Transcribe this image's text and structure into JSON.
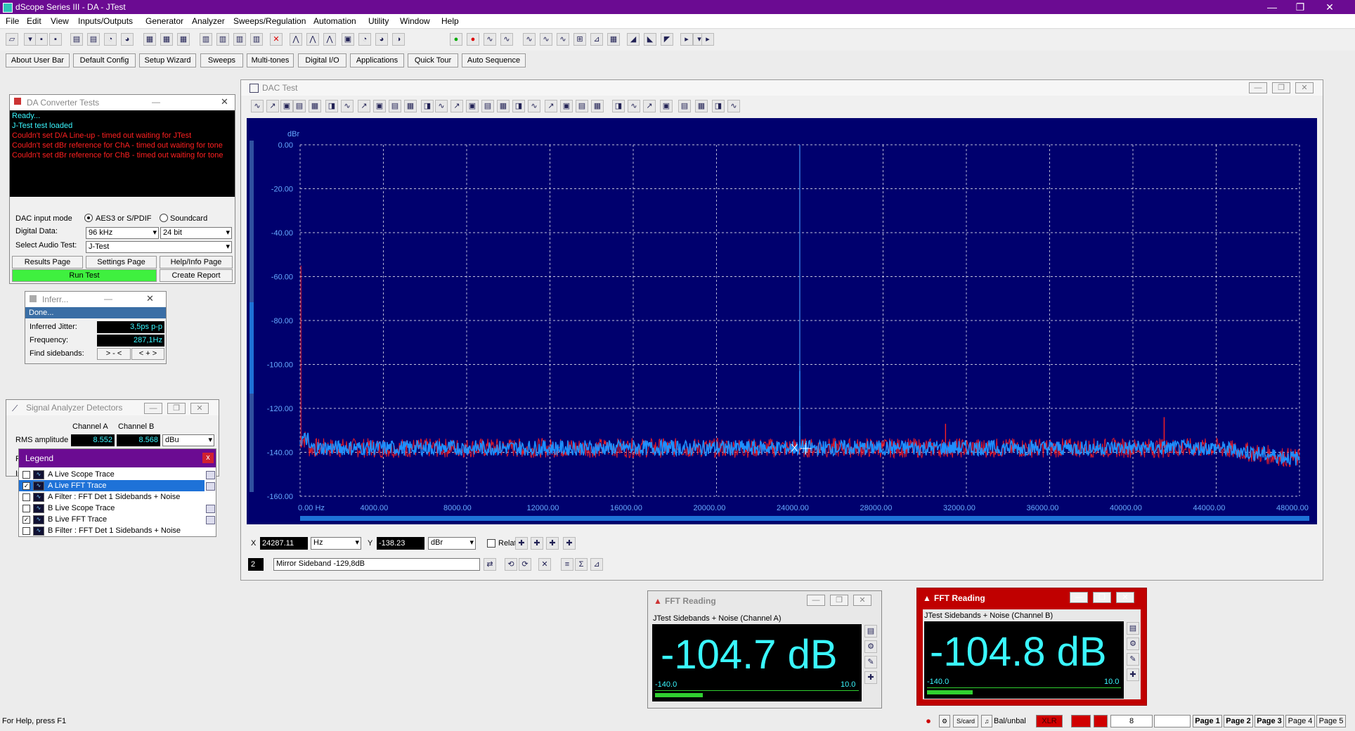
{
  "app": {
    "title": "dScope Series III - DA - JTest"
  },
  "window_controls": {
    "minimize": "—",
    "restore": "❐",
    "close": "✕"
  },
  "menus": [
    "File",
    "Edit",
    "View",
    "Inputs/Outputs",
    "Generator",
    "Analyzer",
    "Sweeps/Regulation",
    "Automation",
    "Utility",
    "Window",
    "Help"
  ],
  "user_bar": [
    "About User Bar",
    "Default Config",
    "Setup Wizard",
    "Sweeps",
    "Multi-tones",
    "Digital I/O",
    "Applications",
    "Quick Tour",
    "Auto Sequence"
  ],
  "dac_tests": {
    "title": "DA Converter Tests",
    "log": [
      {
        "text": "Ready...",
        "color": "#3af7ff"
      },
      {
        "text": "J-Test test loaded",
        "color": "#3af7ff"
      },
      {
        "text": "Couldn't set D/A Line-up - timed out waiting for JTest",
        "color": "#ff2020"
      },
      {
        "text": "Couldn't set dBr reference for ChA - timed out waiting for tone",
        "color": "#ff2020"
      },
      {
        "text": "Couldn't set dBr reference for ChB - timed out waiting for tone",
        "color": "#ff2020"
      }
    ],
    "input_mode_label": "DAC input mode",
    "radio_aes": "AES3 or S/PDIF",
    "radio_soundcard": "Soundcard",
    "digital_data_label": "Digital Data:",
    "sample_rate": "96 kHz",
    "bit_depth": "24 bit",
    "select_test_label": "Select Audio Test:",
    "selected_test": "J-Test",
    "results_page": "Results Page",
    "settings_page": "Settings Page",
    "help_page": "Help/Info Page",
    "run_test": "Run Test",
    "create_report": "Create Report"
  },
  "inferred": {
    "title": "Inferr...",
    "status": "Done...",
    "jitter_label": "Inferred Jitter:",
    "jitter_value": "3,5ps p-p",
    "freq_label": "Frequency:",
    "freq_value": "287,1Hz",
    "sidebands_label": "Find sidebands:",
    "btn_left": "> - <",
    "btn_right": "< + >"
  },
  "detectors": {
    "title": "Signal Analyzer Detectors",
    "col_a": "Channel A",
    "col_b": "Channel B",
    "row_label": "RMS amplitude",
    "val_a": "8.552",
    "val_b": "8.568",
    "unit": "dBu",
    "partial_f": "F",
    "partial_i": "Ir"
  },
  "legend": {
    "title": "Legend",
    "close": "x",
    "items": [
      {
        "label": "A  Live Scope Trace",
        "checked": false
      },
      {
        "label": "A  Live FFT Trace",
        "checked": true
      },
      {
        "label": "A  Filter : FFT Det 1 Sidebands + Noise",
        "checked": false
      },
      {
        "label": "B  Live Scope Trace",
        "checked": false
      },
      {
        "label": "B  Live FFT Trace",
        "checked": true
      },
      {
        "label": "B  Filter : FFT Det 1 Sidebands + Noise",
        "checked": false
      }
    ]
  },
  "dac_test_window": {
    "title": "DAC Test",
    "cursor": {
      "x_label": "X",
      "x_value": "24287.11",
      "x_unit": "Hz",
      "y_label": "Y",
      "y_value": "-138.23",
      "y_unit": "dBr",
      "relative": "Relative"
    },
    "marker": {
      "index": "2",
      "text": "Mirror Sideband -129,8dB"
    }
  },
  "chart_data": {
    "type": "line",
    "ylabel": "dBr",
    "xlabel": "",
    "xlim": [
      0,
      48000
    ],
    "ylim": [
      -160,
      0
    ],
    "x_ticks": [
      "0.00 Hz",
      "4000.00",
      "8000.00",
      "12000.00",
      "16000.00",
      "20000.00",
      "24000.00",
      "28000.00",
      "32000.00",
      "36000.00",
      "40000.00",
      "44000.00",
      "48000.00"
    ],
    "y_ticks": [
      "0.00",
      "-20.00",
      "-40.00",
      "-60.00",
      "-80.00",
      "-100.00",
      "-120.00",
      "-140.00",
      "-160.00"
    ],
    "grid": true,
    "series": [
      {
        "color": "#ff2020",
        "noise_floor": -138,
        "spurs": [
          {
            "x": 31000,
            "y": -127
          },
          {
            "x": 41500,
            "y": -124
          }
        ],
        "tone": {
          "x": 24000,
          "y": 0
        }
      },
      {
        "color": "#1e90ff",
        "noise_floor": -138,
        "spurs": [
          {
            "x": 24000,
            "y": -103
          },
          {
            "x": 24000,
            "y": -128
          }
        ],
        "tone": {
          "x": 24000,
          "y": 0
        }
      }
    ]
  },
  "colors": {
    "plot_bg": "#00006e",
    "grid": "#ffffff",
    "trace_a": "#ff2020",
    "trace_b": "#1e90ff",
    "accent": "#6b0b92"
  },
  "fft_a": {
    "title": "FFT Reading",
    "label": "JTest Sidebands + Noise (Channel A)",
    "value": "-104.7 dB",
    "scale_min": "-140.0",
    "scale_max": "10.0",
    "bar_fraction": 0.236
  },
  "fft_b": {
    "title": "FFT Reading",
    "label": "JTest Sidebands + Noise (Channel B)",
    "value": "-104.8 dB",
    "scale_min": "-140.0",
    "scale_max": "10.0",
    "bar_fraction": 0.235
  },
  "status": {
    "help": "For Help, press F1",
    "scard": "S/card",
    "balunbal": "Bal/unbal",
    "xlr": "XLR",
    "num": "8",
    "pages": [
      "Page 1",
      "Page 2",
      "Page 3",
      "Page 4",
      "Page 5"
    ]
  }
}
